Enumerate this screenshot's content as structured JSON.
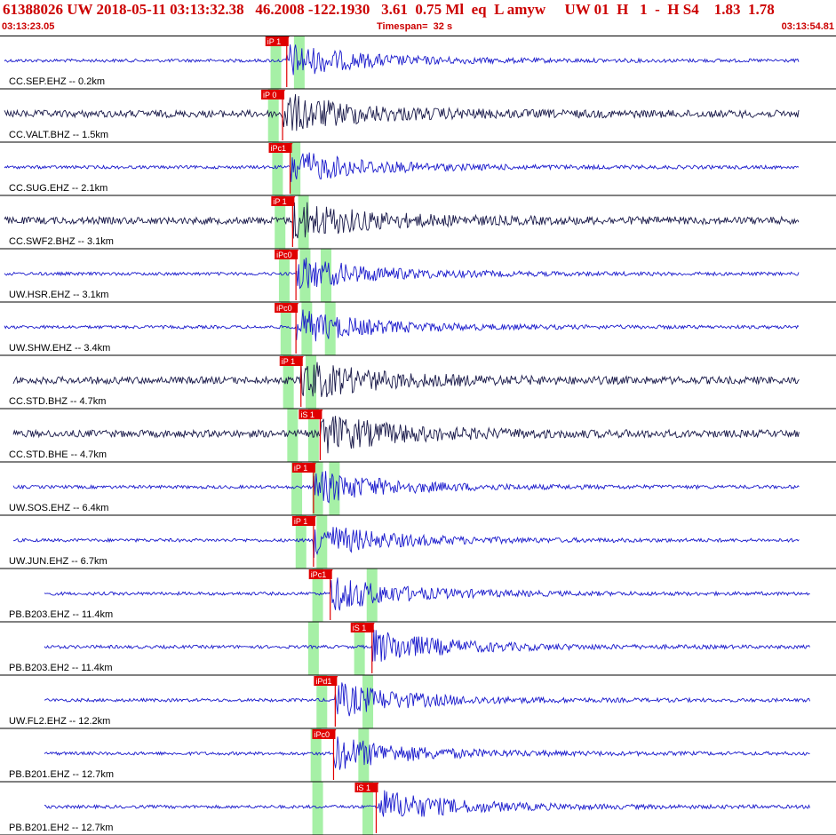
{
  "header": {
    "title": "61388026 UW 2018-05-11 03:13:32.38   46.2008 -122.1930   3.61  0.75 Ml  eq  L amyw     UW 01  H   1  -  H S4    1.83  1.78",
    "start_time": "03:13:23.05",
    "timespan": "Timespan=  32 s",
    "end_time": "03:13:54.81"
  },
  "colors": {
    "trace_blue": "#1a1acc",
    "trace_dark": "#1a1a4a",
    "pick_red": "#e00000",
    "window_green": "#a6f0a6",
    "border": "#000000",
    "header_text": "#cc0000"
  },
  "traces": [
    {
      "label": "CC.SEP.EHZ -- 0.2km",
      "color": "blue",
      "picks": [
        {
          "label": "iP 1",
          "t": 0.343
        }
      ],
      "windows": [
        0.33,
        0.358
      ]
    },
    {
      "label": "CC.VALT.BHZ -- 1.5km",
      "color": "dark",
      "picks": [
        {
          "label": "iP 0",
          "t": 0.338
        }
      ],
      "windows": [
        0.327
      ]
    },
    {
      "label": "CC.SUG.EHZ -- 2.1km",
      "color": "blue",
      "picks": [
        {
          "label": "iPc1",
          "t": 0.347
        }
      ],
      "windows": [
        0.332,
        0.353
      ]
    },
    {
      "label": "CC.SWF2.BHZ -- 3.1km",
      "color": "dark",
      "picks": [
        {
          "label": "iP 1",
          "t": 0.35
        }
      ],
      "windows": [
        0.335,
        0.363
      ]
    },
    {
      "label": "UW.HSR.EHZ -- 3.1km",
      "color": "blue",
      "picks": [
        {
          "label": "iPc0",
          "t": 0.354
        }
      ],
      "windows": [
        0.34,
        0.365,
        0.39
      ]
    },
    {
      "label": "UW.SHW.EHZ -- 3.4km",
      "color": "blue",
      "picks": [
        {
          "label": "iPc0",
          "t": 0.354
        }
      ],
      "windows": [
        0.342,
        0.367,
        0.395
      ]
    },
    {
      "label": "CC.STD.BHZ -- 4.7km",
      "color": "dark",
      "picks": [
        {
          "label": "iP 1",
          "t": 0.36
        }
      ],
      "windows": [
        0.345,
        0.372
      ]
    },
    {
      "label": "CC.STD.BHE -- 4.7km",
      "color": "dark",
      "picks": [
        {
          "label": "iS 1",
          "t": 0.383
        }
      ],
      "windows": [
        0.35,
        0.375
      ]
    },
    {
      "label": "UW.SOS.EHZ -- 6.4km",
      "color": "blue",
      "picks": [
        {
          "label": "iP 1",
          "t": 0.375
        }
      ],
      "windows": [
        0.355,
        0.38,
        0.4
      ]
    },
    {
      "label": "UW.JUN.EHZ -- 6.7km",
      "color": "blue",
      "picks": [
        {
          "label": "iP 1",
          "t": 0.375
        }
      ],
      "windows": [
        0.36,
        0.385
      ]
    },
    {
      "label": "PB.B203.EHZ -- 11.4km",
      "color": "blue",
      "picks": [
        {
          "label": "iPc1",
          "t": 0.395
        }
      ],
      "windows": [
        0.38,
        0.445
      ]
    },
    {
      "label": "PB.B203.EH2 -- 11.4km",
      "color": "blue",
      "picks": [
        {
          "label": "iS 1",
          "t": 0.445
        }
      ],
      "windows": [
        0.375,
        0.43
      ]
    },
    {
      "label": "UW.FL2.EHZ -- 12.2km",
      "color": "blue",
      "picks": [
        {
          "label": "iPd1",
          "t": 0.401
        }
      ],
      "windows": [
        0.385,
        0.44
      ]
    },
    {
      "label": "PB.B201.EHZ -- 12.7km",
      "color": "blue",
      "picks": [
        {
          "label": "iPc0",
          "t": 0.399
        }
      ],
      "windows": [
        0.378,
        0.435
      ]
    },
    {
      "label": "PB.B201.EH2 -- 12.7km",
      "color": "blue",
      "picks": [
        {
          "label": "iS 1",
          "t": 0.45
        }
      ],
      "windows": [
        0.38,
        0.44
      ]
    }
  ]
}
